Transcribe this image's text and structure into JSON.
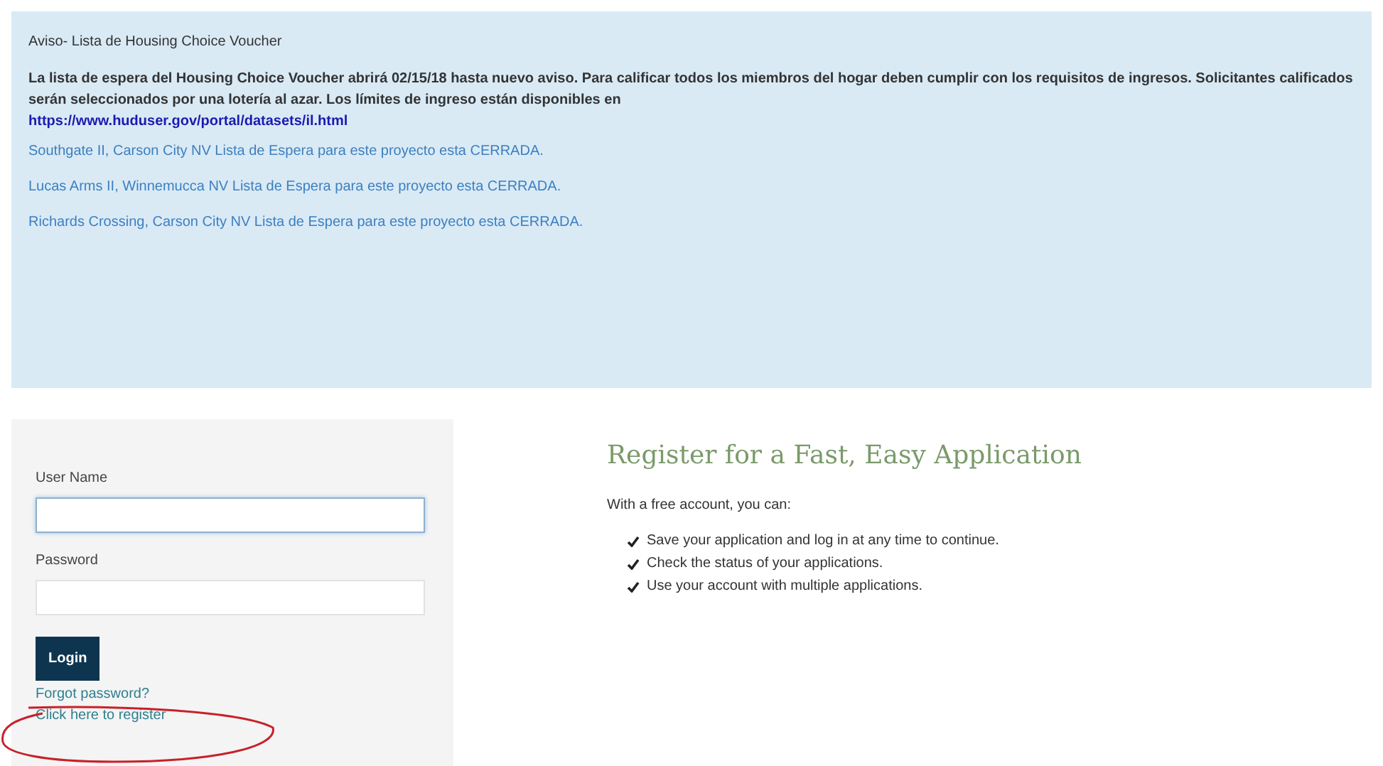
{
  "notice": {
    "title": "Aviso- Lista de Housing Choice Voucher",
    "body": "La lista de espera del Housing Choice Voucher abrirá 02/15/18 hasta nuevo aviso. Para calificar todos los miembros del hogar deben cumplir con los requisitos de ingresos. Solicitantes calificados serán seleccionados por una lotería al azar. Los límites de ingreso están disponibles en",
    "link": "https://www.huduser.gov/portal/datasets/il.html",
    "closures": [
      "Southgate II, Carson City NV Lista de Espera para este proyecto esta CERRADA.",
      "Lucas Arms II, Winnemucca NV Lista de Espera para este proyecto esta CERRADA.",
      "Richards Crossing, Carson City NV Lista de Espera para este proyecto esta CERRADA."
    ]
  },
  "login": {
    "fields": [
      {
        "label": "User Name",
        "focused": true
      },
      {
        "label": "Password",
        "focused": false
      }
    ],
    "button": "Login",
    "links": [
      "Forgot password?",
      "Click here to register"
    ]
  },
  "register": {
    "heading": "Register for a Fast, Easy Application",
    "intro": "With a free account, you can:",
    "benefits": [
      "Save your application and log in at any time to continue.",
      "Check the status of your applications.",
      "Use your account with multiple applications."
    ]
  }
}
